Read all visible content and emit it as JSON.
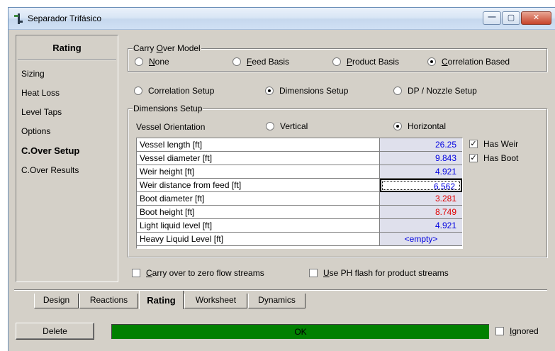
{
  "window": {
    "title": "Separador Trifásico",
    "controls": [
      "minimize",
      "maximize",
      "close"
    ]
  },
  "sidebar": {
    "header": "Rating",
    "items": [
      {
        "label": "Sizing",
        "bold": false
      },
      {
        "label": "Heat Loss",
        "bold": false
      },
      {
        "label": "Level Taps",
        "bold": false
      },
      {
        "label": "Options",
        "bold": false
      },
      {
        "label": "C.Over Setup",
        "bold": true
      },
      {
        "label": "C.Over Results",
        "bold": false
      }
    ]
  },
  "carry_over_model": {
    "title_pre": "Carry ",
    "title_ul": "O",
    "title_post": "ver Model",
    "options": [
      {
        "pre": "",
        "ul": "N",
        "post": "one",
        "selected": false
      },
      {
        "pre": "",
        "ul": "F",
        "post": "eed Basis",
        "selected": false
      },
      {
        "pre": "",
        "ul": "P",
        "post": "roduct Basis",
        "selected": false
      },
      {
        "pre": "",
        "ul": "C",
        "post": "orrelation Based",
        "selected": true
      }
    ]
  },
  "setup_modes": [
    {
      "label": "Correlation Setup",
      "selected": false
    },
    {
      "label": "Dimensions Setup",
      "selected": true
    },
    {
      "label": "DP / Nozzle Setup",
      "selected": false
    }
  ],
  "dimensions": {
    "title": "Dimensions Setup",
    "orientation_label": "Vessel Orientation",
    "orientation_options": [
      {
        "label": "Vertical",
        "selected": false
      },
      {
        "label": "Horizontal",
        "selected": true
      }
    ],
    "rows": [
      {
        "label": "Vessel length [ft]",
        "value": "26.25",
        "color": "blue"
      },
      {
        "label": "Vessel diameter [ft]",
        "value": "9.843",
        "color": "blue"
      },
      {
        "label": "Weir height [ft]",
        "value": "4.921",
        "color": "blue"
      },
      {
        "label": "Weir distance from feed [ft]",
        "value": "6.562",
        "color": "blue",
        "selected": true
      },
      {
        "label": "Boot diameter [ft]",
        "value": "3.281",
        "color": "red"
      },
      {
        "label": "Boot height [ft]",
        "value": "8.749",
        "color": "red"
      },
      {
        "label": "Light liquid level [ft]",
        "value": "4.921",
        "color": "blue"
      },
      {
        "label": "Heavy Liquid Level [ft]",
        "value": "<empty>",
        "color": "blue"
      }
    ],
    "has_weir": {
      "label": "Has Weir",
      "checked": true
    },
    "has_boot": {
      "label": "Has Boot",
      "checked": true
    }
  },
  "options": {
    "carry_over_zero": {
      "pre": "",
      "ul": "C",
      "post": "arry over to zero flow streams",
      "checked": false
    },
    "use_ph_flash": {
      "pre": "",
      "ul": "U",
      "post": "se PH flash for product streams",
      "checked": false
    }
  },
  "tabs": [
    {
      "label": "Design",
      "active": false
    },
    {
      "label": "Reactions",
      "active": false
    },
    {
      "label": "Rating",
      "active": true
    },
    {
      "label": "Worksheet",
      "active": false
    },
    {
      "label": "Dynamics",
      "active": false
    }
  ],
  "footer": {
    "delete_label": "Delete",
    "status_text": "OK",
    "status_color": "#008000",
    "ignored": {
      "pre": "",
      "ul": "I",
      "post": "gnored",
      "checked": false
    }
  }
}
